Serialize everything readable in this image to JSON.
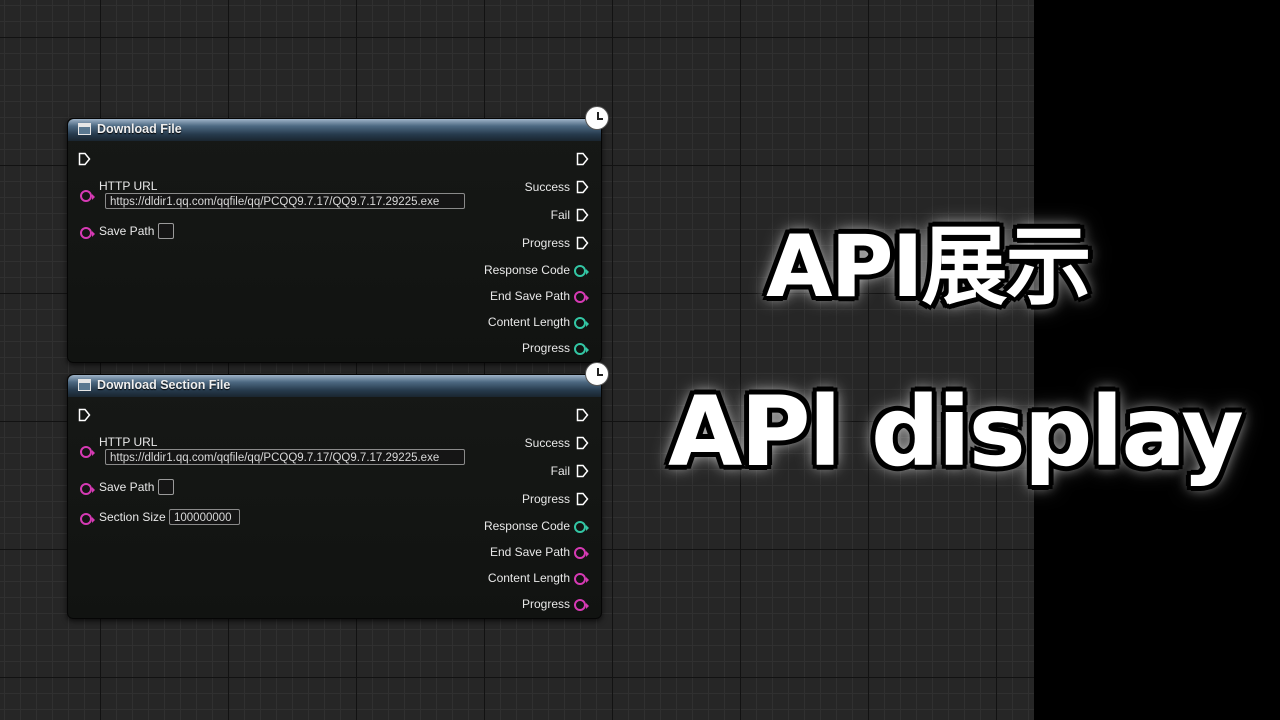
{
  "overlay": {
    "title_cn": "API展示",
    "title_en": "APl display"
  },
  "nodes": [
    {
      "title": "Download File",
      "inputs": {
        "http_url_label": "HTTP URL",
        "http_url_value": "https://dldir1.qq.com/qqfile/qq/PCQQ9.7.17/QQ9.7.17.29225.exe",
        "save_path_label": "Save Path"
      },
      "outputs": {
        "success": "Success",
        "fail": "Fail",
        "progress_exec": "Progress",
        "response_code": "Response Code",
        "end_save_path": "End Save Path",
        "content_length": "Content Length",
        "progress": "Progress"
      }
    },
    {
      "title": "Download Section File",
      "inputs": {
        "http_url_label": "HTTP URL",
        "http_url_value": "https://dldir1.qq.com/qqfile/qq/PCQQ9.7.17/QQ9.7.17.29225.exe",
        "save_path_label": "Save Path",
        "section_size_label": "Section Size",
        "section_size_value": "100000000"
      },
      "outputs": {
        "success": "Success",
        "fail": "Fail",
        "progress_exec": "Progress",
        "response_code": "Response Code",
        "end_save_path": "End Save Path",
        "content_length": "Content Length",
        "progress": "Progress"
      }
    }
  ],
  "pin_colors": {
    "string": "#d63ab4",
    "integer": "#33c6a4",
    "exec": "#ffffff"
  }
}
